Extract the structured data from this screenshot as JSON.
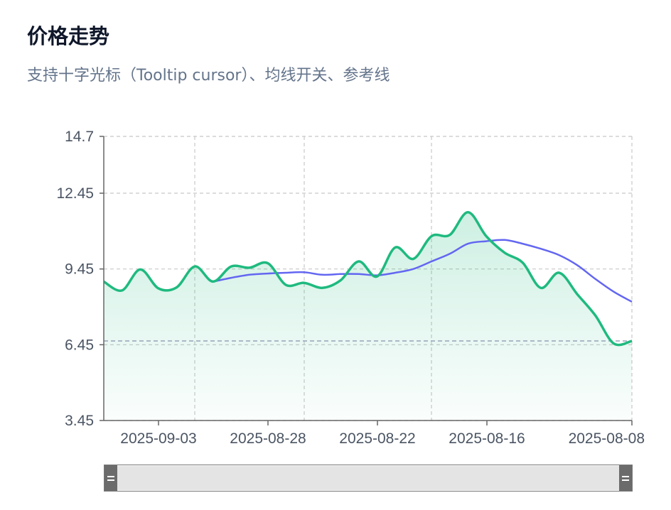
{
  "header": {
    "title": "价格走势",
    "subtitle": "支持十字光标（Tooltip cursor）、均线开关、参考线"
  },
  "colors": {
    "price_line": "#1fba7f",
    "price_area": "#1fba7f",
    "ma_line": "#6366f1",
    "reference_line": "#94a3b8",
    "grid": "#c8c8c8",
    "axis": "#666666"
  },
  "chart_data": {
    "type": "line",
    "x_ticks": [
      "2025-09-03",
      "2025-08-28",
      "2025-08-22",
      "2025-08-16",
      "2025-08-08"
    ],
    "y_ticks": [
      "14.7",
      "12.45",
      "9.45",
      "6.45",
      "3.45"
    ],
    "ylim": [
      3.45,
      14.7
    ],
    "grid": true,
    "reference_line": {
      "y": 6.6,
      "style": "dashed"
    },
    "series": [
      {
        "values": [
          8.95,
          8.6,
          9.43,
          8.68,
          8.72,
          9.55,
          8.95,
          9.55,
          9.5,
          9.68,
          8.82,
          8.9,
          8.7,
          9.0,
          9.75,
          9.15,
          10.3,
          9.85,
          10.75,
          10.8,
          11.7,
          10.75,
          10.1,
          9.7,
          8.7,
          9.3,
          8.45,
          7.6,
          6.5,
          6.6
        ],
        "area": true
      },
      {
        "values": [
          null,
          null,
          null,
          null,
          null,
          null,
          8.95,
          9.1,
          9.22,
          9.27,
          9.3,
          9.32,
          9.22,
          9.25,
          9.25,
          9.2,
          9.3,
          9.45,
          9.75,
          10.05,
          10.45,
          10.55,
          10.6,
          10.45,
          10.25,
          10.0,
          9.6,
          9.05,
          8.55,
          8.15
        ]
      }
    ]
  }
}
